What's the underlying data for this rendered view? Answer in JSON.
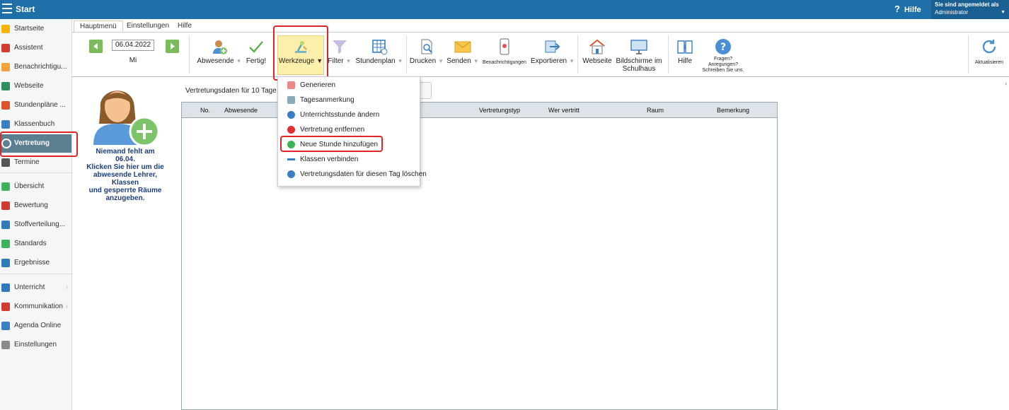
{
  "topbar": {
    "title": "Start",
    "help_label": "Hilfe",
    "help_symbol": "?",
    "login_label": "Sie sind angemeldet als",
    "login_user": "Administrator"
  },
  "sidebar": {
    "items": [
      {
        "label": "Startseite",
        "icon": "star-icon",
        "color": "#f4b400"
      },
      {
        "label": "Assistent",
        "icon": "wand-icon",
        "color": "#d23b2f"
      },
      {
        "label": "Benachrichtigu...",
        "icon": "envelope-icon",
        "color": "#f0a33a"
      },
      {
        "label": "Webseite",
        "icon": "home-icon",
        "color": "#2f8f5f"
      },
      {
        "label": "Stundenpläne ...",
        "icon": "calendar-grid-icon",
        "color": "#d9532c"
      },
      {
        "label": "Klassenbuch",
        "icon": "book-icon",
        "color": "#3a7fc1"
      },
      {
        "label": "Vertretung",
        "icon": "person-swap-icon",
        "color": "#ffffff"
      },
      {
        "label": "Termine",
        "icon": "calendar-icon",
        "color": "#555555"
      },
      {
        "label": "Übersicht",
        "icon": "check-circle-icon",
        "color": "#3cb35a"
      },
      {
        "label": "Bewertung",
        "icon": "rating-icon",
        "color": "#d23b2f"
      },
      {
        "label": "Stoffverteilung...",
        "icon": "briefcase-icon",
        "color": "#2f7ab8"
      },
      {
        "label": "Standards",
        "icon": "shield-check-icon",
        "color": "#3cb35a"
      },
      {
        "label": "Ergebnisse",
        "icon": "bar-chart-icon",
        "color": "#2f7ab8"
      },
      {
        "label": "Unterricht",
        "icon": "open-book-icon",
        "color": "#2f7ab8"
      },
      {
        "label": "Kommunikation",
        "icon": "chat-icon",
        "color": "#d23b2f"
      },
      {
        "label": "Agenda Online",
        "icon": "pen-icon",
        "color": "#3a7fc1"
      },
      {
        "label": "Einstellungen",
        "icon": "gear-icon",
        "color": "#888888"
      }
    ]
  },
  "tabs": [
    "Hauptmenü",
    "Einstellungen",
    "Hilfe"
  ],
  "toolbar": {
    "date": "06.04.2022",
    "weekday": "Mi",
    "abwesende": "Abwesende",
    "fertig": "Fertig!",
    "werkzeuge": "Werkzeuge",
    "werkzeuge_arrow": "▼",
    "filter": "Filter",
    "stundenplan": "Stundenplan",
    "drucken": "Drucken",
    "senden": "Senden",
    "benachrichtigungen": "Benachrichtigungen",
    "exportieren": "Exportieren",
    "webseite": "Webseite",
    "bildschirme_1": "Bildschirme im",
    "bildschirme_2": "Schulhaus",
    "hilfe": "Hilfe",
    "fragen_1": "Fragen?",
    "fragen_2": "Anregungen?",
    "fragen_3": "Schreiben Sie uns.",
    "aktualisieren": "Aktualisieren",
    "dropdown_arrow": "▼"
  },
  "absent_panel": {
    "line1": "Niemand fehlt am",
    "line2": "06.04.",
    "line3": "Klicken Sie hier um die",
    "line4": "abwesende Lehrer, Klassen",
    "line5": "und gesperrte Räume",
    "line6": "anzugeben."
  },
  "main": {
    "title_fragment": "Vertretungsdaten für 10 Tage wu",
    "button_fragment": "en",
    "columns": [
      "No.",
      "Abwesende",
      "Vertretungstyp",
      "Wer vertritt",
      "Raum",
      "Bemerkung"
    ]
  },
  "werkzeuge_menu": {
    "items": [
      {
        "label": "Generieren",
        "icon": "generate-icon",
        "color": "#e88"
      },
      {
        "label": "Tagesanmerkung",
        "icon": "note-icon",
        "color": "#8ab"
      },
      {
        "label": "Unterrichtsstunde ändern",
        "icon": "refresh-icon",
        "color": "#3a7fc1"
      },
      {
        "label": "Vertretung entfernen",
        "icon": "remove-circle-icon",
        "color": "#e03030"
      },
      {
        "label": "Neue Stunde hinzufügen",
        "icon": "add-circle-icon",
        "color": "#3cb35a"
      },
      {
        "label": "Klassen verbinden",
        "icon": "link-arrows-icon",
        "color": "#3a7fc1"
      },
      {
        "label": "Vertretungsdaten für diesen Tag löschen",
        "icon": "delete-data-icon",
        "color": "#3a7fc1"
      }
    ]
  }
}
